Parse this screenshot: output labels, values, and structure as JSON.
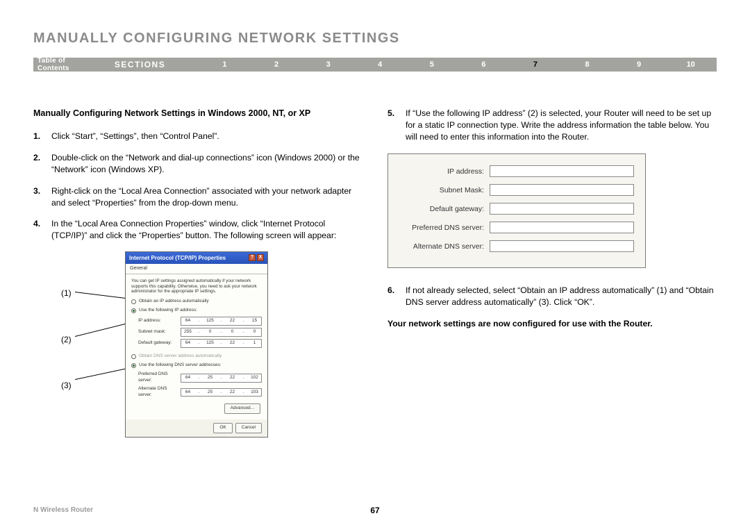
{
  "title": "MANUALLY CONFIGURING NETWORK SETTINGS",
  "nav": {
    "toc": "Table of Contents",
    "sections_label": "SECTIONS",
    "items": [
      "1",
      "2",
      "3",
      "4",
      "5",
      "6",
      "7",
      "8",
      "9",
      "10"
    ],
    "active": "7"
  },
  "subhead": "Manually Configuring Network Settings in Windows 2000, NT, or XP",
  "steps_left": [
    {
      "n": "1.",
      "t": "Click “Start”, “Settings”, then “Control Panel”."
    },
    {
      "n": "2.",
      "t": "Double-click on the “Network and dial-up connections” icon (Windows 2000) or the “Network” icon (Windows XP)."
    },
    {
      "n": "3.",
      "t": "Right-click on the “Local Area Connection” associated with your network adapter and select “Properties” from the drop-down menu."
    },
    {
      "n": "4.",
      "t": "In the “Local Area Connection Properties” window, click “Internet Protocol (TCP/IP)” and click the “Properties” button. The following screen will appear:"
    }
  ],
  "callouts": [
    "(1)",
    "(2)",
    "(3)"
  ],
  "dialog": {
    "title": "Internet Protocol (TCP/IP) Properties",
    "tab": "General",
    "desc": "You can get IP settings assigned automatically if your network supports this capability. Otherwise, you need to ask your network administrator for the appropriate IP settings.",
    "radio1": "Obtain an IP address automatically",
    "radio2": "Use the following IP address:",
    "ip_label": "IP address:",
    "ip": [
      "64",
      "125",
      "22",
      "15"
    ],
    "mask_label": "Subnet mask:",
    "mask": [
      "255",
      "0",
      "0",
      "0"
    ],
    "gw_label": "Default gateway:",
    "gw": [
      "64",
      "125",
      "22",
      "1"
    ],
    "radio3": "Obtain DNS server address automatically",
    "radio4": "Use the following DNS server addresses:",
    "pdns_label": "Preferred DNS server:",
    "pdns": [
      "64",
      "25",
      "22",
      "102"
    ],
    "adns_label": "Alternate DNS server:",
    "adns": [
      "64",
      "25",
      "22",
      "103"
    ],
    "advanced": "Advanced...",
    "ok": "OK",
    "cancel": "Cancel"
  },
  "steps_right": [
    {
      "n": "5.",
      "t": "If “Use the following IP address” (2) is selected, your Router will need to be set up for a static IP connection type. Write the address information the table below. You will need to enter this information into the Router."
    },
    {
      "n": "6.",
      "t": "If not already selected, select “Obtain an IP address automatically” (1) and “Obtain DNS server address automatically” (3). Click “OK”."
    }
  ],
  "addr_fields": [
    "IP address:",
    "Subnet Mask:",
    "Default gateway:",
    "Preferred DNS server:",
    "Alternate DNS server:"
  ],
  "final_line": "Your network settings are now configured for use with the Router.",
  "footer_left": "N Wireless Router",
  "page_number": "67"
}
